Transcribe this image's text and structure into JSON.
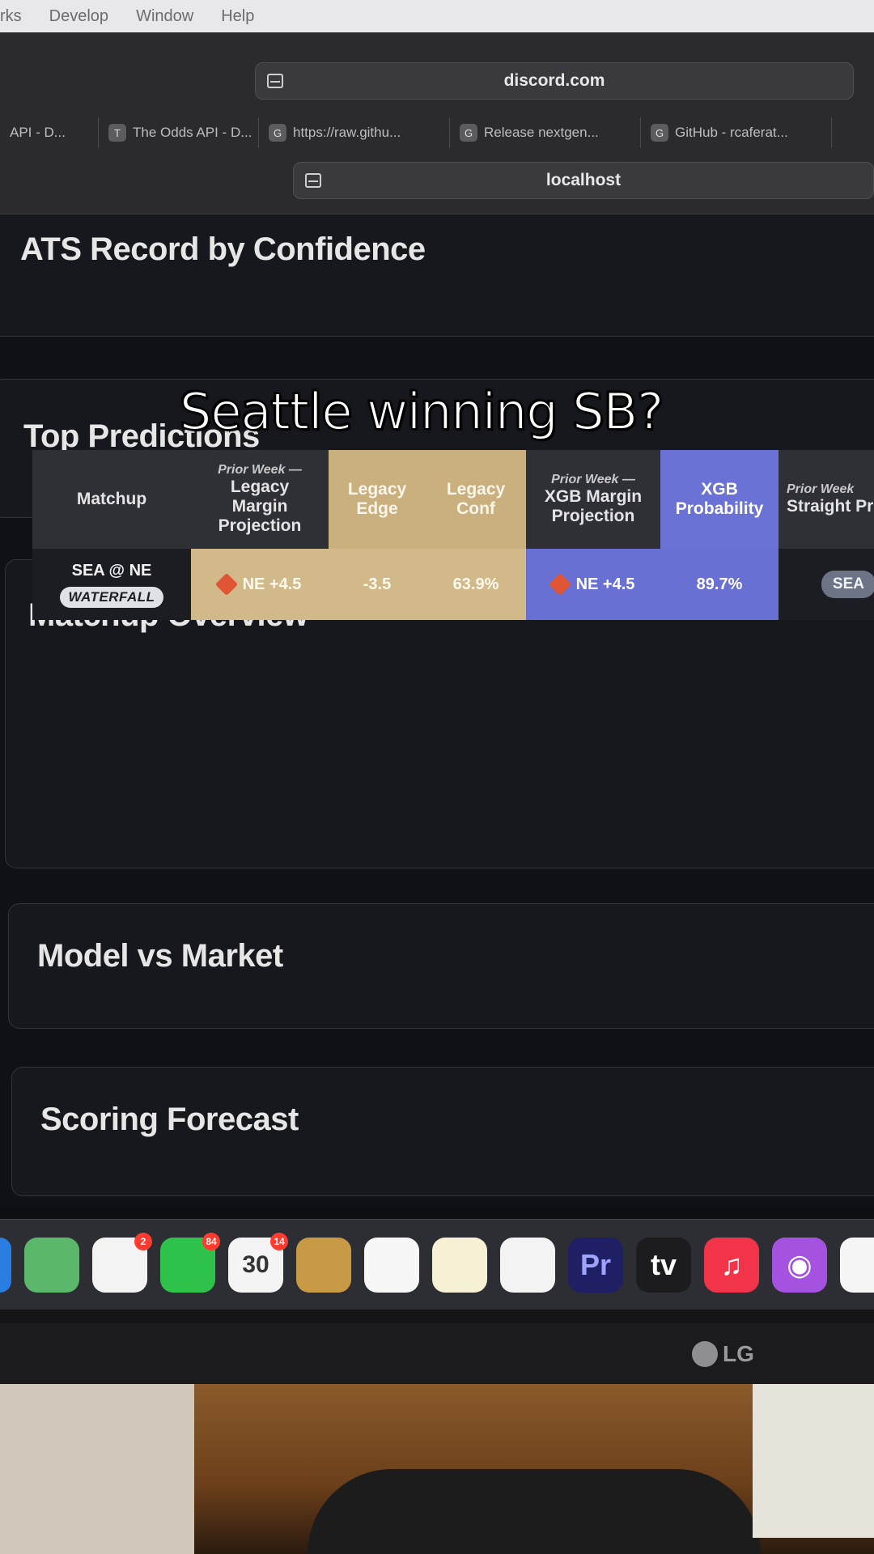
{
  "menubar": {
    "items": [
      "rks",
      "Develop",
      "Window",
      "Help"
    ]
  },
  "browser": {
    "url_top": "discord.com",
    "url_active": "localhost",
    "tabs": [
      {
        "fav": "",
        "label": "API - D..."
      },
      {
        "fav": "T",
        "label": "The Odds API - D..."
      },
      {
        "fav": "G",
        "label": "https://raw.githu..."
      },
      {
        "fav": "G",
        "label": "Release nextgen..."
      },
      {
        "fav": "G",
        "label": "GitHub - rcaferat..."
      }
    ]
  },
  "dashboard": {
    "sections": {
      "ats": "ATS Record by Confidence",
      "top": "Top Predictions",
      "matchup": "Matchup Overview",
      "model": "Model vs Market",
      "scoring": "Scoring Forecast"
    },
    "matchup_table": {
      "headers": {
        "matchup": "Matchup",
        "legacy_margin_pre": "Prior Week —",
        "legacy_margin": "Legacy Margin Projection",
        "legacy_edge": "Legacy Edge",
        "legacy_conf": "Legacy Conf",
        "xgb_margin_pre": "Prior Week —",
        "xgb_margin": "XGB Margin Projection",
        "xgb_prob": "XGB Probability",
        "straight_pre": "Prior Week",
        "straight": "Straight Projectio"
      },
      "row": {
        "matchup": "SEA @ NE",
        "tag": "WATERFALL",
        "legacy_margin": "NE +4.5",
        "legacy_edge": "-3.5",
        "legacy_conf": "63.9%",
        "xgb_margin": "NE +4.5",
        "xgb_prob": "89.7%",
        "straight": "SEA"
      }
    }
  },
  "overlay": {
    "caption": "Seattle winning SB?"
  },
  "dock": {
    "apps": [
      {
        "icon": "finder-icon",
        "color": "#2a7de1",
        "glyph": ""
      },
      {
        "icon": "maps-icon",
        "color": "#5bb86a",
        "glyph": ""
      },
      {
        "icon": "photos-icon",
        "color": "#f3f3f3",
        "glyph": "",
        "badge": "2"
      },
      {
        "icon": "facetime-icon",
        "color": "#2fc24a",
        "glyph": "",
        "badge": "84"
      },
      {
        "icon": "calendar-icon",
        "color": "#f4f4f4",
        "glyph": "30",
        "badge": "14"
      },
      {
        "icon": "contacts-icon",
        "color": "#c99a45",
        "glyph": ""
      },
      {
        "icon": "reminders-icon",
        "color": "#f7f7f7",
        "glyph": ""
      },
      {
        "icon": "notes-icon",
        "color": "#f6f1d4",
        "glyph": ""
      },
      {
        "icon": "freeform-icon",
        "color": "#f3f3f3",
        "glyph": ""
      },
      {
        "icon": "premiere-icon",
        "color": "#1f1f66",
        "glyph": "Pr"
      },
      {
        "icon": "appletv-icon",
        "color": "#1c1c1e",
        "glyph": "tv"
      },
      {
        "icon": "music-icon",
        "color": "#f2344a",
        "glyph": "♫"
      },
      {
        "icon": "podcasts-icon",
        "color": "#a552e0",
        "glyph": "◉"
      },
      {
        "icon": "news-icon",
        "color": "#f5f5f5",
        "glyph": ""
      }
    ]
  },
  "monitor": {
    "brand": "LG"
  }
}
